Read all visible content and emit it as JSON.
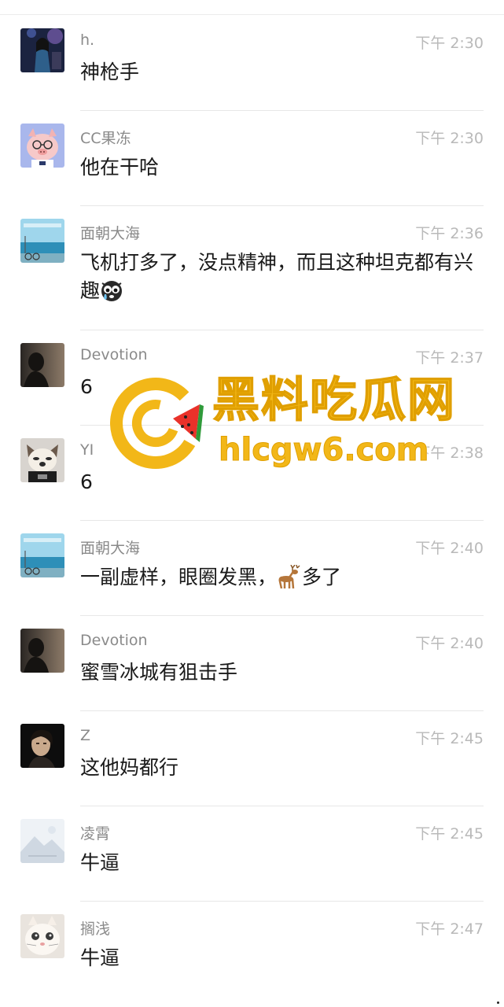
{
  "messages": [
    {
      "name": "h.",
      "time": "下午 2:30",
      "text": "神枪手",
      "avatar": "avatar-girl-stage"
    },
    {
      "name": "CC果冻",
      "time": "下午 2:30",
      "text": "他在干哈",
      "avatar": "avatar-pig-glasses"
    },
    {
      "name": "面朝大海",
      "time": "下午 2:36",
      "text": "飞机打多了，没点精神，而且这种坦克都有兴趣",
      "emoji": "crying-face",
      "avatar": "avatar-sea"
    },
    {
      "name": "Devotion",
      "time": "下午 2:37",
      "text": "6",
      "avatar": "avatar-dark-silhouette"
    },
    {
      "name": "YI",
      "time": "下午 2:38",
      "text": "6",
      "avatar": "avatar-dog"
    },
    {
      "name": "面朝大海",
      "time": "下午 2:40",
      "text_before": "一副虚样，眼圈发黑，",
      "emoji": "deer",
      "text_after": "多了",
      "avatar": "avatar-sea"
    },
    {
      "name": "Devotion",
      "time": "下午 2:40",
      "text": "蜜雪冰城有狙击手",
      "avatar": "avatar-dark-silhouette"
    },
    {
      "name": "Z",
      "time": "下午 2:45",
      "text": "这他妈都行",
      "avatar": "avatar-dark-portrait"
    },
    {
      "name": "凌霄",
      "time": "下午 2:45",
      "text": "牛逼",
      "avatar": "avatar-placeholder-mountain"
    },
    {
      "name": "搁浅",
      "time": "下午 2:47",
      "text": "牛逼",
      "avatar": "avatar-cat"
    }
  ],
  "watermark": {
    "title": "黑料吃瓜网",
    "url": "hlcgw6.com",
    "logo": "watermelon-c-logo"
  },
  "colors": {
    "name": "#8a8a8a",
    "time": "#b9b9b9",
    "text": "#1a1a1a",
    "watermark": "#f2b718"
  }
}
